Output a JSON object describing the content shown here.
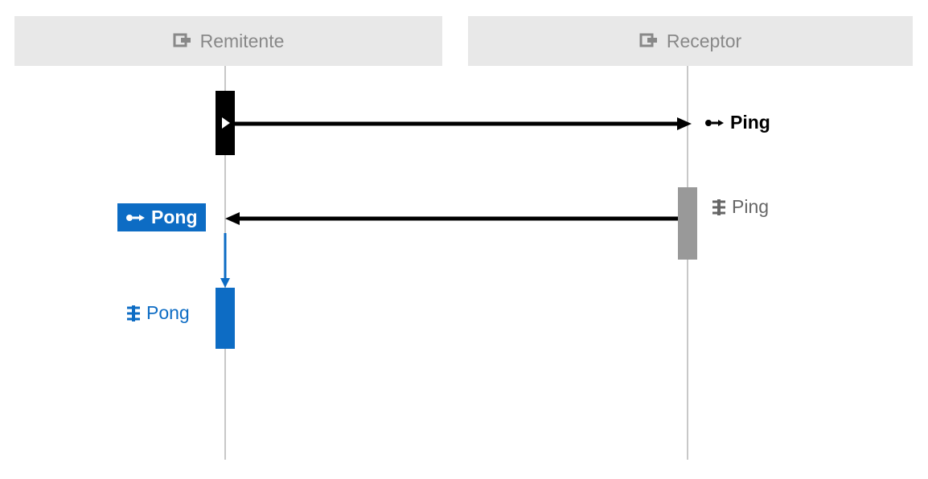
{
  "participants": {
    "left": {
      "label": "Remitente"
    },
    "right": {
      "label": "Receptor"
    }
  },
  "messages": {
    "ping_send": {
      "label": "Ping"
    },
    "ping_recv": {
      "label": "Ping"
    },
    "pong_send": {
      "label": "Pong"
    },
    "pong_recv": {
      "label": "Pong"
    }
  },
  "colors": {
    "header_bg": "#e8e8e8",
    "header_text": "#888888",
    "lifeline": "#c8c8c8",
    "black": "#000000",
    "gray": "#999999",
    "blue": "#0d6cc4"
  }
}
